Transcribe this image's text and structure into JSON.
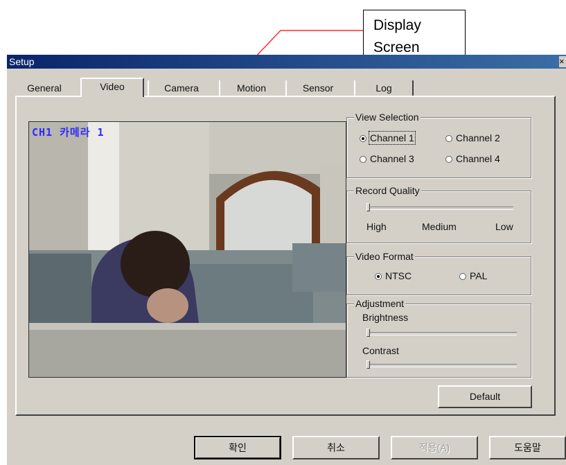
{
  "callout": {
    "line1": "Display",
    "line2": "Screen"
  },
  "window": {
    "title": "Setup",
    "close_glyph": "×"
  },
  "tabs": [
    {
      "label": "General",
      "active": false
    },
    {
      "label": "Video",
      "active": true
    },
    {
      "label": "Camera",
      "active": false
    },
    {
      "label": "Motion",
      "active": false
    },
    {
      "label": "Sensor",
      "active": false
    },
    {
      "label": "Log",
      "active": false
    }
  ],
  "video": {
    "overlay_text": "CH1 카메라 1"
  },
  "view_selection": {
    "title": "View Selection",
    "options": [
      "Channel 1",
      "Channel 2",
      "Channel 3",
      "Channel 4"
    ],
    "selected": "Channel 1"
  },
  "record_quality": {
    "title": "Record Quality",
    "labels": [
      "High",
      "Medium",
      "Low"
    ],
    "slider_value": 0
  },
  "video_format": {
    "title": "Video Format",
    "options": [
      "NTSC",
      "PAL"
    ],
    "selected": "NTSC"
  },
  "adjustment": {
    "title": "Adjustment",
    "brightness_label": "Brightness",
    "brightness_value": 0,
    "contrast_label": "Contrast",
    "contrast_value": 0
  },
  "default_button": "Default",
  "footer": {
    "ok": "확인",
    "cancel": "취소",
    "apply": "적용(A)",
    "help": "도움말"
  },
  "colors": {
    "title_bar": "#0a246a",
    "dialog_bg": "#d4d0c8",
    "overlay_text": "#2b2bff",
    "callout_line": "#ff0000"
  }
}
